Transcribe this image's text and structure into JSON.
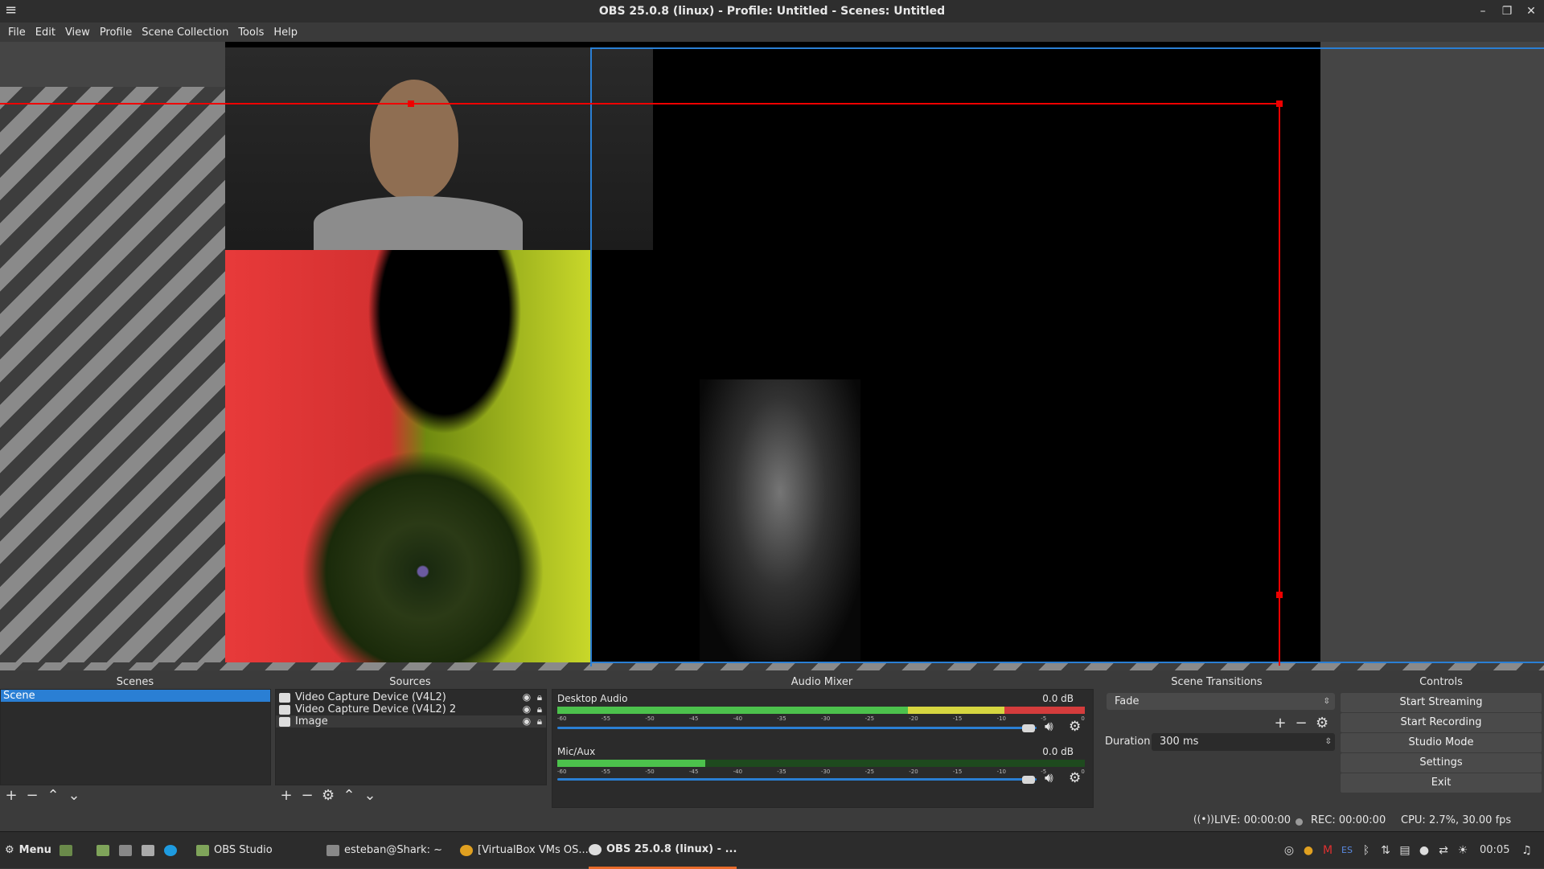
{
  "window": {
    "title": "OBS 25.0.8 (linux) - Profile: Untitled - Scenes: Untitled"
  },
  "menu": [
    "File",
    "Edit",
    "View",
    "Profile",
    "Scene Collection",
    "Tools",
    "Help"
  ],
  "scenes": {
    "title": "Scenes",
    "items": [
      "Scene"
    ]
  },
  "sources": {
    "title": "Sources",
    "items": [
      {
        "name": "Video Capture Device (V4L2)",
        "icon": "camera-icon"
      },
      {
        "name": "Video Capture Device (V4L2) 2",
        "icon": "camera-icon"
      },
      {
        "name": "Image",
        "icon": "image-icon"
      }
    ]
  },
  "mixer": {
    "title": "Audio Mixer",
    "channels": [
      {
        "name": "Desktop Audio",
        "db": "0.0 dB",
        "level": 0.9
      },
      {
        "name": "Mic/Aux",
        "db": "0.0 dB",
        "level": 0.28
      }
    ],
    "scale": [
      "-60",
      "-55",
      "-50",
      "-45",
      "-40",
      "-35",
      "-30",
      "-25",
      "-20",
      "-15",
      "-10",
      "-5",
      "0"
    ]
  },
  "transitions": {
    "title": "Scene Transitions",
    "selected": "Fade",
    "duration_label": "Duration",
    "duration_value": "300 ms"
  },
  "controls": {
    "title": "Controls",
    "buttons": [
      "Start Streaming",
      "Start Recording",
      "Studio Mode",
      "Settings",
      "Exit"
    ]
  },
  "status": {
    "live": "LIVE: 00:00:00",
    "rec": "REC: 00:00:00",
    "cpu": "CPU: 2.7%, 30.00 fps"
  },
  "taskbar": {
    "menu": "Menu",
    "apps": [
      "OBS Studio",
      "esteban@Shark: ~",
      "[VirtualBox VMs OS...",
      "OBS 25.0.8 (linux) - ..."
    ],
    "lang": "ES",
    "clock": "00:05"
  },
  "colors": {
    "accent": "#2a7fd4",
    "selection": "#e00000",
    "meter_green": "#4cc14c",
    "meter_yellow": "#d6d640",
    "meter_red": "#d43c3c"
  }
}
